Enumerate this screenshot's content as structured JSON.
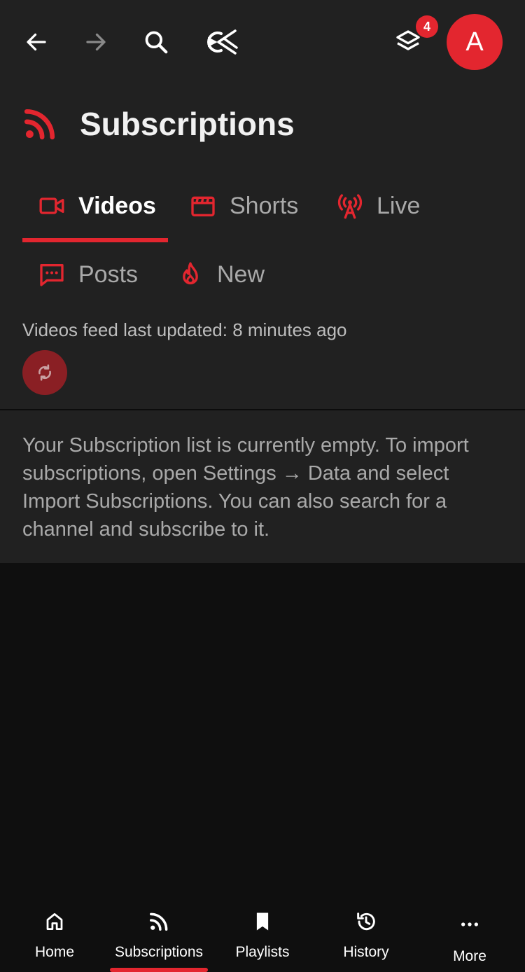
{
  "colors": {
    "accent": "#e3262f",
    "surface": "#212121",
    "background": "#0f0f0f",
    "muted_text": "#a9a9a9"
  },
  "topbar": {
    "icons": [
      "back-arrow-icon",
      "forward-arrow-icon",
      "search-icon",
      "logo-icon",
      "layers-icon"
    ],
    "badge_count": "4",
    "avatar_letter": "A"
  },
  "header": {
    "icon": "rss-icon",
    "title": "Subscriptions"
  },
  "tabs": [
    {
      "label": "Videos",
      "icon": "video-camera-icon",
      "active": true
    },
    {
      "label": "Shorts",
      "icon": "clapperboard-icon",
      "active": false
    },
    {
      "label": "Live",
      "icon": "broadcast-tower-icon",
      "active": false
    },
    {
      "label": "Posts",
      "icon": "message-bubble-icon",
      "active": false
    },
    {
      "label": "New",
      "icon": "fire-icon",
      "active": false
    }
  ],
  "feed": {
    "updated_text": "Videos feed last updated: 8 minutes ago",
    "refresh_icon": "refresh-icon"
  },
  "empty_message": "Your Subscription list is currently empty. To import subscriptions, open Settings → Data and select Import Subscriptions. You can also search for a channel and subscribe to it.",
  "bottom_nav": [
    {
      "label": "Home",
      "icon": "home-icon",
      "active": false
    },
    {
      "label": "Subscriptions",
      "icon": "rss-icon",
      "active": true
    },
    {
      "label": "Playlists",
      "icon": "bookmark-icon",
      "active": false
    },
    {
      "label": "History",
      "icon": "history-icon",
      "active": false
    },
    {
      "label": "More",
      "icon": "more-dots-icon",
      "active": false
    }
  ]
}
